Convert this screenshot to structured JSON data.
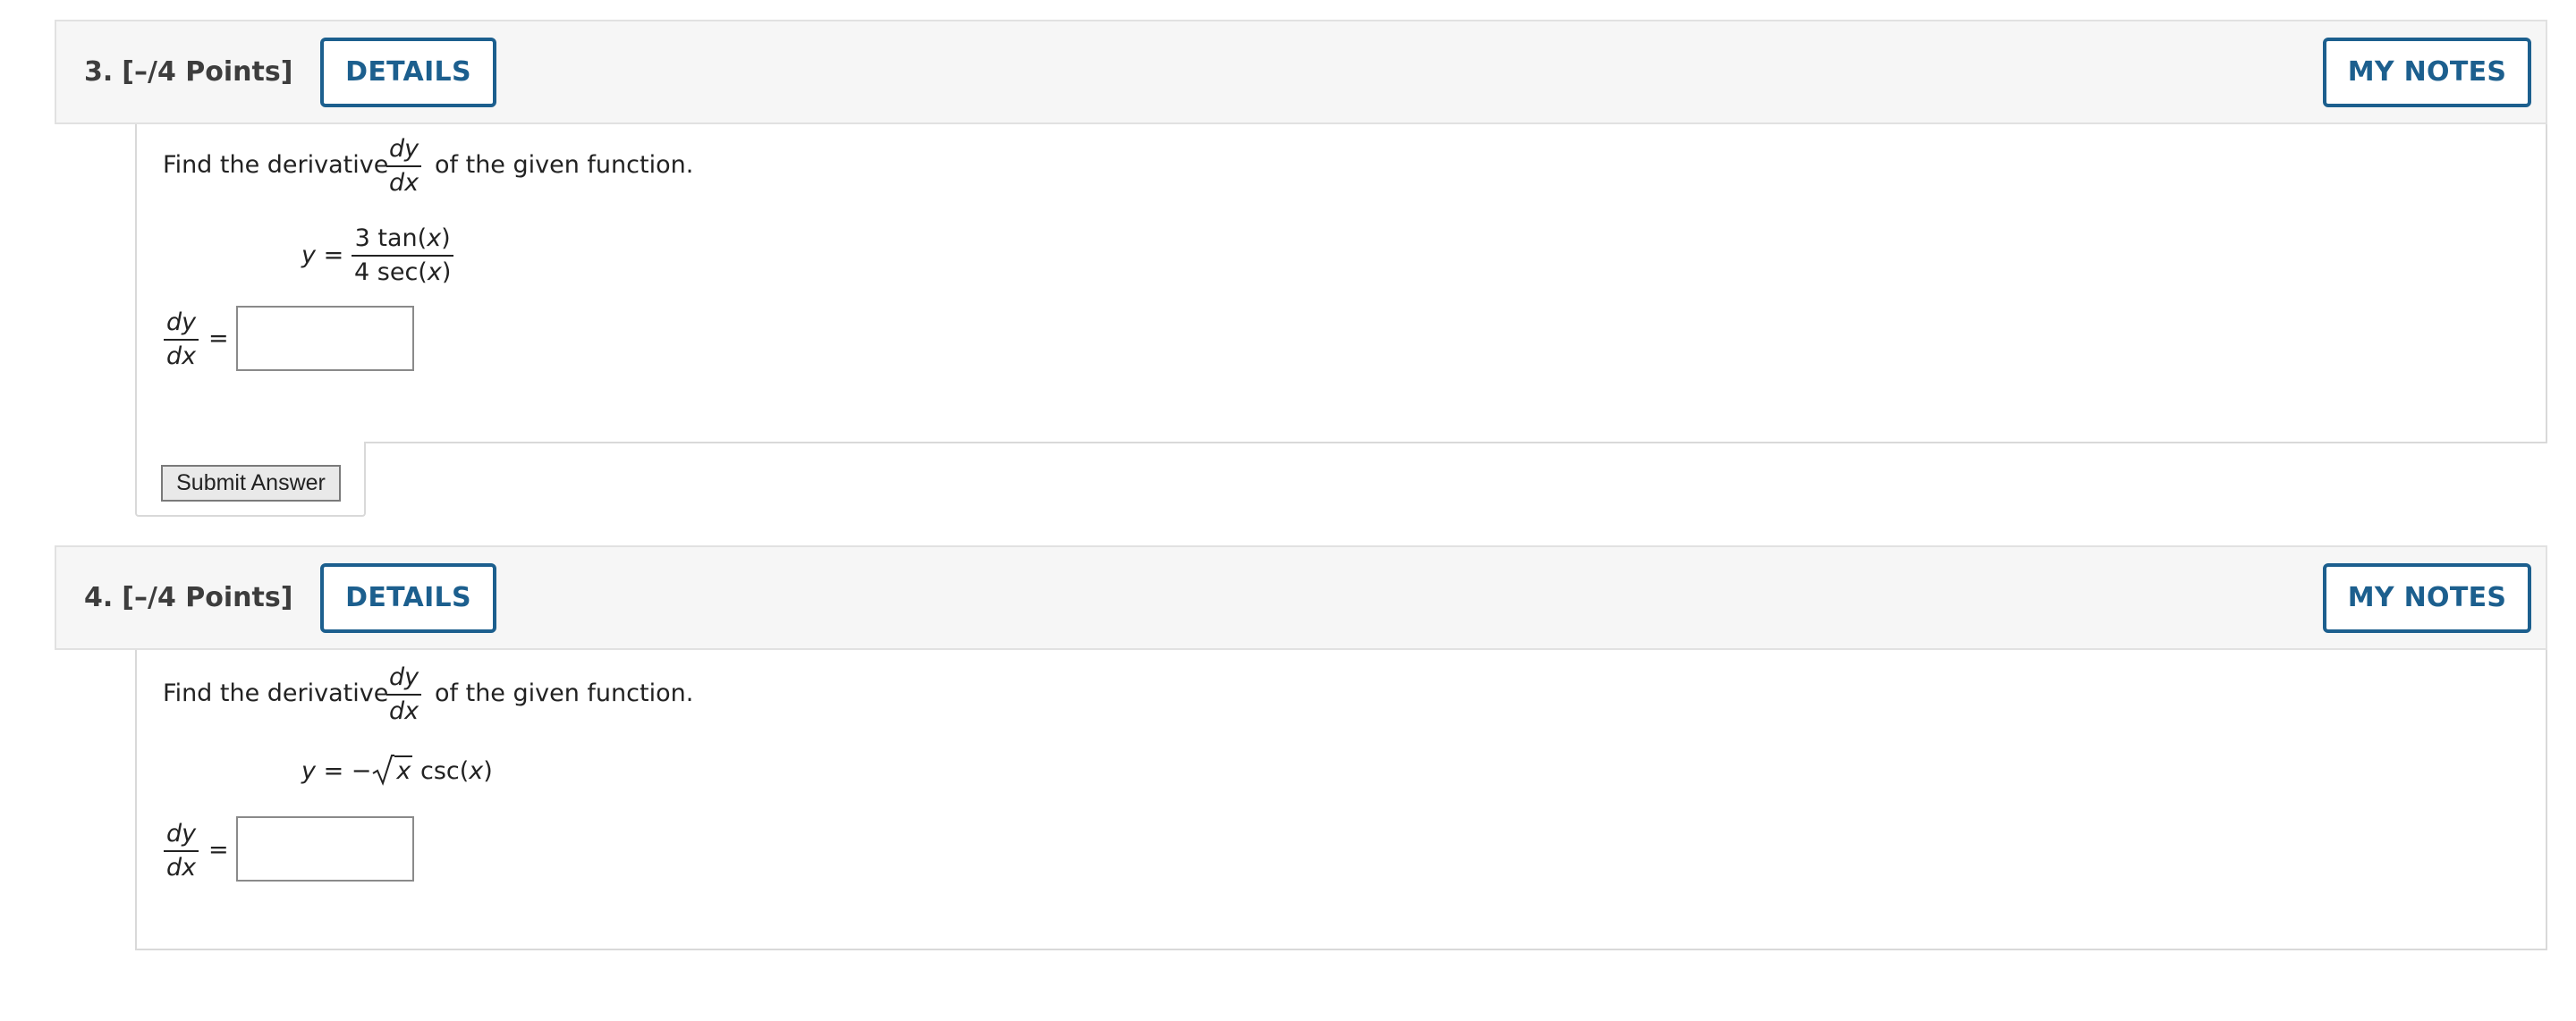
{
  "questions": [
    {
      "number": "3.",
      "points": "[–/4 Points]",
      "details_label": "DETAILS",
      "notes_label": "MY NOTES",
      "prompt_before": "Find the derivative",
      "prompt_after": "of the given function.",
      "deriv_num": "dy",
      "deriv_den": "dx",
      "function": {
        "lhs": "y =",
        "num_coef": "3 tan(",
        "num_var": "x",
        "num_close": ")",
        "den_coef": "4 sec(",
        "den_var": "x",
        "den_close": ")"
      },
      "answer_lhs_num": "dy",
      "answer_lhs_den": "dx",
      "equals": "=",
      "answer_value": "",
      "submit_label": "Submit Answer"
    },
    {
      "number": "4.",
      "points": "[–/4 Points]",
      "details_label": "DETAILS",
      "notes_label": "MY NOTES",
      "prompt_before": "Find the derivative",
      "prompt_after": "of the given function.",
      "deriv_num": "dy",
      "deriv_den": "dx",
      "function": {
        "lhs": "y = −",
        "radicand": "x",
        "tail": "csc(",
        "tail_var": "x",
        "tail_close": ")"
      },
      "answer_lhs_num": "dy",
      "answer_lhs_den": "dx",
      "equals": "=",
      "answer_value": ""
    }
  ],
  "colors": {
    "accent": "#1c5f8e",
    "header_bg": "#f6f6f6",
    "border": "#d9d9d9"
  }
}
